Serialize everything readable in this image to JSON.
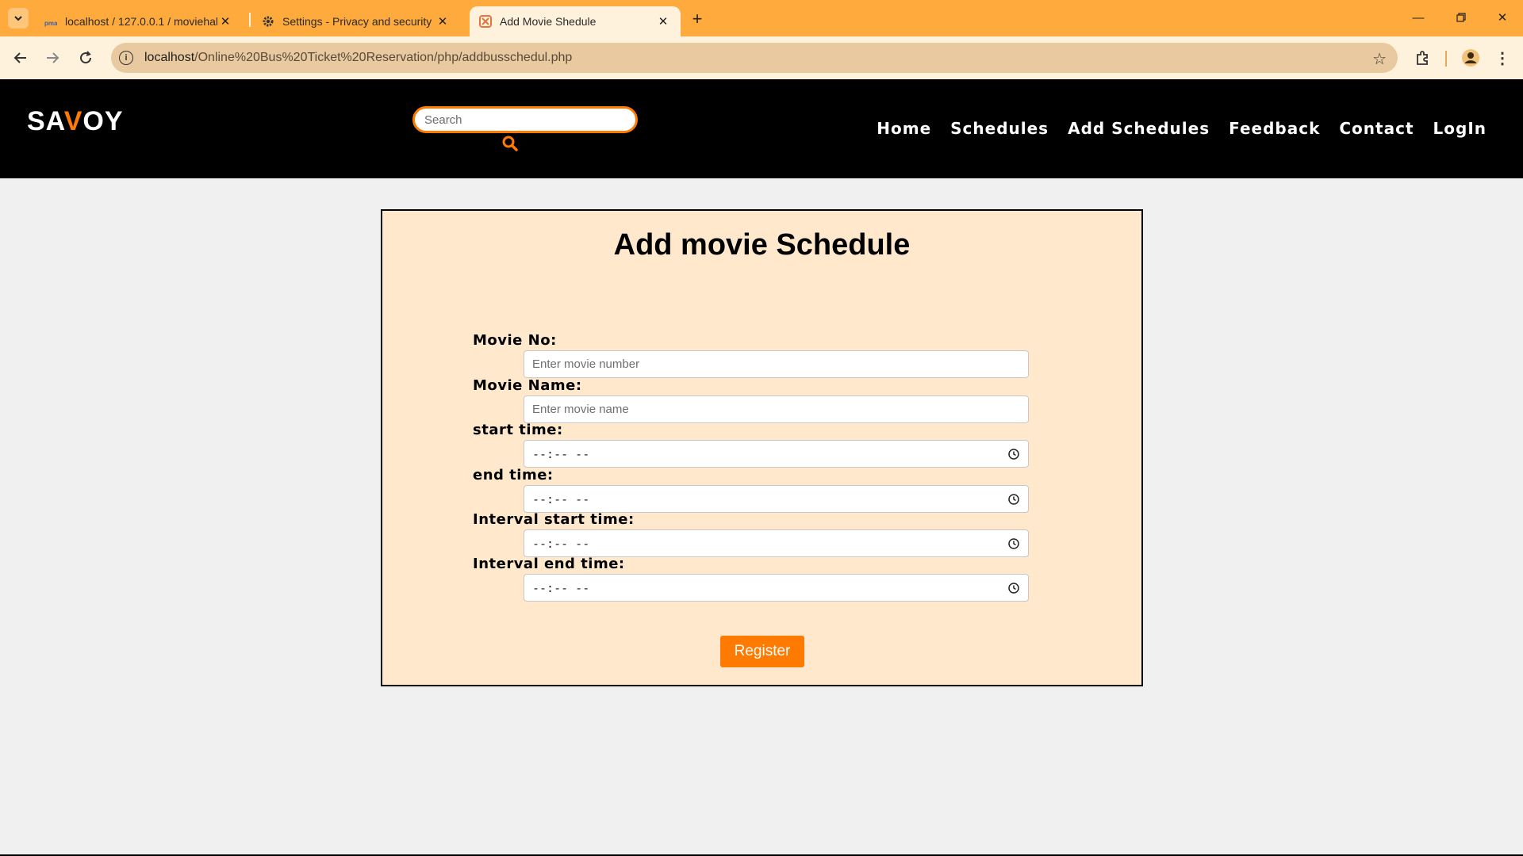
{
  "browser": {
    "tabs": [
      {
        "title": "localhost / 127.0.0.1 / moviehal",
        "icon": "phpmyadmin-icon"
      },
      {
        "title": "Settings - Privacy and security",
        "icon": "gear-icon"
      },
      {
        "title": "Add Movie Shedule",
        "icon": "xampp-icon"
      }
    ],
    "address": {
      "host": "localhost",
      "path": "/Online%20Bus%20Ticket%20Reservation/php/addbusschedul.php"
    }
  },
  "site": {
    "logo": {
      "part1": "SA",
      "accent": "V",
      "part2": "OY"
    },
    "search": {
      "placeholder": "Search"
    },
    "nav": [
      "Home",
      "Schedules",
      "Add Schedules",
      "Feedback",
      "Contact",
      "LogIn"
    ]
  },
  "form": {
    "title": "Add movie Schedule",
    "fields": [
      {
        "label": "Movie No:",
        "placeholder": "Enter movie number"
      },
      {
        "label": "Movie Name:",
        "placeholder": "Enter movie name"
      },
      {
        "label": "start time:",
        "value": "--:-- --"
      },
      {
        "label": "end time:",
        "value": "--:-- --"
      },
      {
        "label": "Interval start time:",
        "value": "--:-- --"
      },
      {
        "label": "Interval end time:",
        "value": "--:-- --"
      }
    ],
    "submit_label": "Register"
  },
  "colors": {
    "chrome": "#ffaa3d",
    "accent": "#ff7a00",
    "panel": "#ffe8cc",
    "header": "#000000"
  }
}
